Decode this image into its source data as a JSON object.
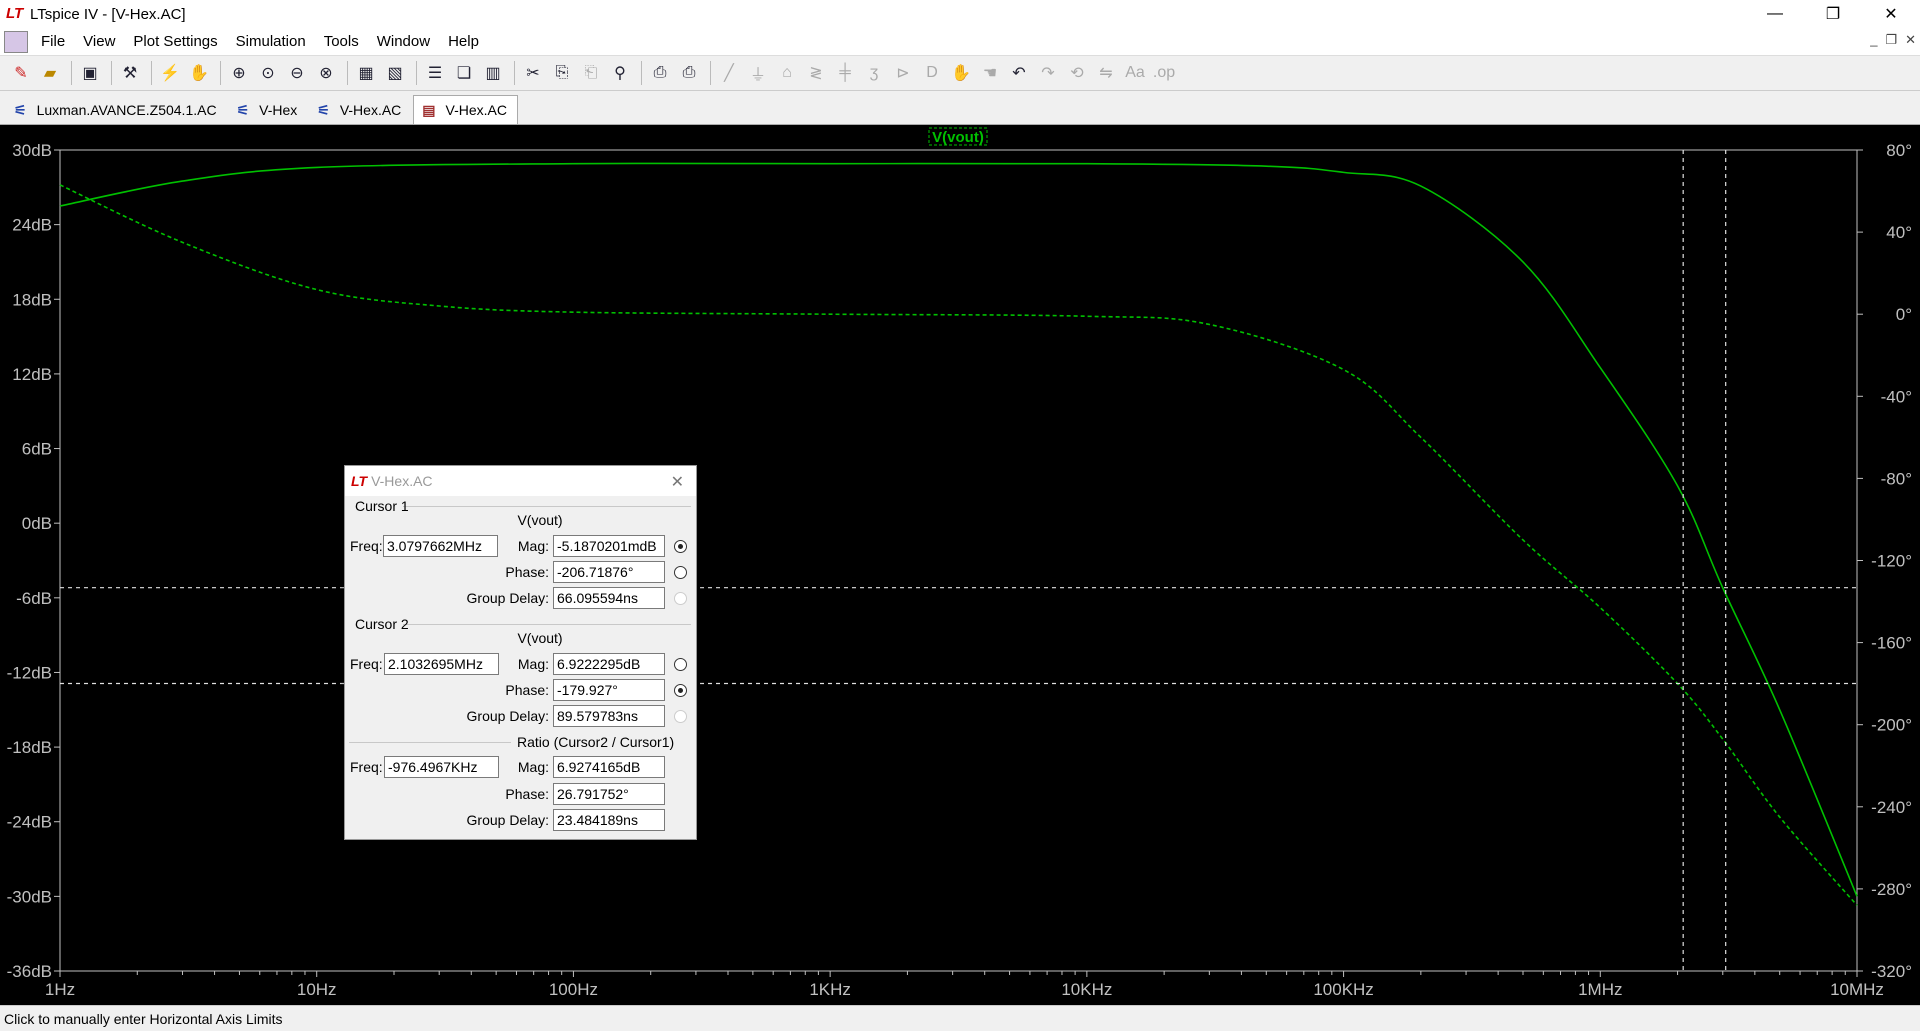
{
  "window": {
    "title": "LTspice IV - [V-Hex.AC]",
    "minimize": "—",
    "restore": "❐",
    "close": "✕"
  },
  "menu": {
    "items": [
      "File",
      "View",
      "Plot Settings",
      "Simulation",
      "Tools",
      "Window",
      "Help"
    ]
  },
  "toolbar": {
    "icons": [
      "new-schematic-icon",
      "open-icon",
      "save-icon",
      "control-panel-icon",
      "run-icon",
      "halt-icon",
      "zoom-in-icon",
      "zoom-extents-icon",
      "zoom-out-icon",
      "zoom-cancel-icon",
      "autorange-icon",
      "measure-icon",
      "tile-horizontal-icon",
      "cascade-icon",
      "tile-vertical-icon",
      "cut-icon",
      "copy-icon",
      "paste-icon",
      "find-icon",
      "print-setup-icon",
      "print-icon",
      "wire-icon",
      "ground-icon",
      "label-icon",
      "resistor-icon",
      "capacitor-icon",
      "inductor-icon",
      "diode-icon",
      "component-icon",
      "move-icon",
      "drag-icon",
      "undo-icon",
      "redo-icon",
      "rotate-icon",
      "mirror-icon",
      "text-icon",
      "spice-directive-icon"
    ]
  },
  "tabs": [
    {
      "label": "Luxman.AVANCE.Z504.1.AC",
      "active": false
    },
    {
      "label": "V-Hex",
      "active": false
    },
    {
      "label": "V-Hex.AC",
      "active": false
    },
    {
      "label": "V-Hex.AC",
      "active": true
    }
  ],
  "plot": {
    "trace_label": "V(vout)",
    "trace_color": "#00c000",
    "left_axis_ticks": [
      "30dB",
      "24dB",
      "18dB",
      "12dB",
      "6dB",
      "0dB",
      "-6dB",
      "-12dB",
      "-18dB",
      "-24dB",
      "-30dB",
      "-36dB"
    ],
    "right_axis_ticks": [
      "80°",
      "40°",
      "0°",
      "-40°",
      "-80°",
      "-120°",
      "-160°",
      "-200°",
      "-240°",
      "-280°",
      "-320°"
    ],
    "x_axis_ticks": [
      "1Hz",
      "10Hz",
      "100Hz",
      "1KHz",
      "10KHz",
      "100KHz",
      "1MHz",
      "10MHz"
    ]
  },
  "chart_data": {
    "type": "line",
    "title": "V(vout)",
    "x_scale": "log",
    "xlim": [
      1,
      10000000
    ],
    "ylim_left_db": [
      -36,
      30
    ],
    "ylim_right_deg": [
      -320,
      80
    ],
    "grid": false,
    "series": [
      {
        "name": "V(vout)",
        "axis": "magnitude",
        "style": "solid",
        "x": [
          1,
          3,
          10,
          100,
          1000,
          10000,
          50000,
          100000,
          200000,
          500000,
          1000000,
          2000000,
          3000000,
          5000000,
          10000000
        ],
        "y": [
          25.5,
          27.5,
          28.6,
          28.9,
          28.9,
          28.9,
          28.7,
          28.2,
          27.1,
          21,
          12.5,
          3,
          -5.2,
          -15,
          -30
        ]
      },
      {
        "name": "V(vout)",
        "axis": "phase",
        "style": "dashed",
        "x": [
          1,
          3,
          10,
          30,
          100,
          1000,
          10000,
          30000,
          100000,
          200000,
          500000,
          1000000,
          2000000,
          3000000,
          5000000,
          10000000
        ],
        "y": [
          63,
          35,
          12,
          4,
          1,
          0,
          -1,
          -5,
          -27,
          -60,
          -110,
          -143,
          -180,
          -207,
          -245,
          -288
        ]
      }
    ],
    "cursors": [
      {
        "name": "Cursor 1",
        "freq_hz": 3079766,
        "mag_db": -5.187
      },
      {
        "name": "Cursor 2",
        "freq_hz": 2103270,
        "phase_deg": -179.927
      }
    ]
  },
  "dialog": {
    "title": "V-Hex.AC",
    "cursor1": {
      "group": "Cursor 1",
      "trace": "V(vout)",
      "freq_label": "Freq:",
      "freq": "3.0797662MHz",
      "mag_label": "Mag:",
      "mag": "-5.1870201mdB",
      "phase_label": "Phase:",
      "phase": "-206.71876°",
      "gd_label": "Group Delay:",
      "gd": "66.095594ns"
    },
    "cursor2": {
      "group": "Cursor 2",
      "trace": "V(vout)",
      "freq_label": "Freq:",
      "freq": "2.1032695MHz",
      "mag_label": "Mag:",
      "mag": "6.9222295dB",
      "phase_label": "Phase:",
      "phase": "-179.927°",
      "gd_label": "Group Delay:",
      "gd": "89.579783ns"
    },
    "ratio": {
      "group": "Ratio (Cursor2 / Cursor1)",
      "freq_label": "Freq:",
      "freq": "-976.4967KHz",
      "mag_label": "Mag:",
      "mag": "6.9274165dB",
      "phase_label": "Phase:",
      "phase": "26.791752°",
      "gd_label": "Group Delay:",
      "gd": "23.484189ns"
    }
  },
  "status": {
    "text": "Click to manually enter Horizontal Axis Limits"
  }
}
